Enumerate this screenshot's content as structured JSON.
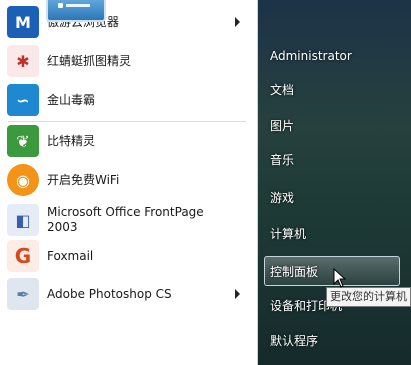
{
  "programs": [
    {
      "label": "傲游云浏览器",
      "icon": "maxthon-icon",
      "color": "#1b5fb7",
      "glyph": "M",
      "has_submenu": true
    },
    {
      "label": "红蜻蜓抓图精灵",
      "icon": "dragonfly-icon",
      "color": "#c2302d",
      "glyph": "✱",
      "has_submenu": false
    },
    {
      "label": "金山毒霸",
      "icon": "kingsoft-antivirus-icon",
      "color": "#1e88d1",
      "glyph": "∽",
      "has_submenu": false
    },
    {
      "label": "比特精灵",
      "icon": "bitcomet-icon",
      "color": "#3a9a3d",
      "glyph": "❦",
      "has_submenu": false
    },
    {
      "label": "开启免费WiFi",
      "icon": "free-wifi-icon",
      "color": "#f39418",
      "glyph": "◉",
      "has_submenu": false
    },
    {
      "label": "Microsoft Office FrontPage\n2003",
      "icon": "frontpage-icon",
      "color": "#3b5ea8",
      "glyph": "◧",
      "has_submenu": false
    },
    {
      "label": "Foxmail",
      "icon": "foxmail-icon",
      "color": "#d24a1e",
      "glyph": "G",
      "has_submenu": false
    },
    {
      "label": "Adobe Photoshop CS",
      "icon": "photoshop-icon",
      "color": "#5a7aa8",
      "glyph": "✒",
      "has_submenu": true
    }
  ],
  "right_menu": [
    {
      "label": "Administrator",
      "name": "user-name"
    },
    {
      "label": "文档",
      "name": "documents"
    },
    {
      "label": "图片",
      "name": "pictures"
    },
    {
      "label": "音乐",
      "name": "music"
    },
    {
      "label": "游戏",
      "name": "games"
    },
    {
      "label": "计算机",
      "name": "computer"
    },
    {
      "label": "控制面板",
      "name": "control-panel"
    },
    {
      "label": "设备和打印机",
      "name": "devices-and-printers"
    },
    {
      "label": "默认程序",
      "name": "default-programs"
    }
  ],
  "tooltip": "更改您的计算机",
  "colors": {
    "highlight_border": "#dcebf5",
    "pane_top": "#2b4a63",
    "pane_bottom": "#1f3a30"
  }
}
